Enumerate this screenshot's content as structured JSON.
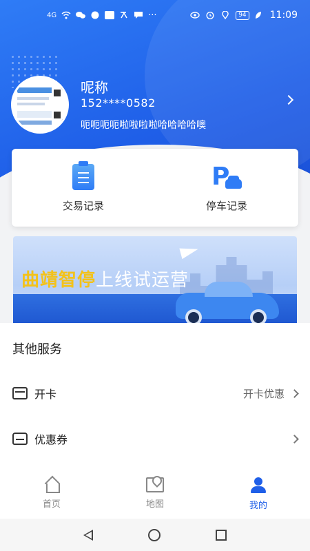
{
  "status_bar": {
    "signal_text": "4G",
    "battery": "94",
    "time": "11:09",
    "icons": [
      "signal-icon",
      "wifi-icon",
      "wechat-icon",
      "app-icon",
      "telegram-icon",
      "translate-icon",
      "message-icon",
      "more-icon",
      "eye-icon",
      "alarm-icon",
      "location-icon",
      "leaf-icon"
    ]
  },
  "profile": {
    "nickname": "呢称",
    "phone": "152****0582",
    "signature": "呃呃呃呃啦啦啦啦哈哈哈哈噢"
  },
  "quick_actions": [
    {
      "label": "交易记录",
      "icon": "transaction-icon"
    },
    {
      "label": "停车记录",
      "icon": "parking-icon"
    }
  ],
  "banner": {
    "title_highlight": "曲靖智停",
    "title_rest": "上线试运营"
  },
  "services": {
    "title": "其他服务",
    "items": [
      {
        "label": "开卡",
        "value": "开卡优惠",
        "icon": "card-icon"
      },
      {
        "label": "优惠券",
        "value": "",
        "icon": "coupon-icon"
      }
    ]
  },
  "tabs": [
    {
      "label": "首页",
      "icon": "home-icon",
      "active": false
    },
    {
      "label": "地图",
      "icon": "map-icon",
      "active": false
    },
    {
      "label": "我的",
      "icon": "user-icon",
      "active": true
    }
  ],
  "colors": {
    "primary": "#1f5fe8",
    "accent": "#f3c21a"
  }
}
